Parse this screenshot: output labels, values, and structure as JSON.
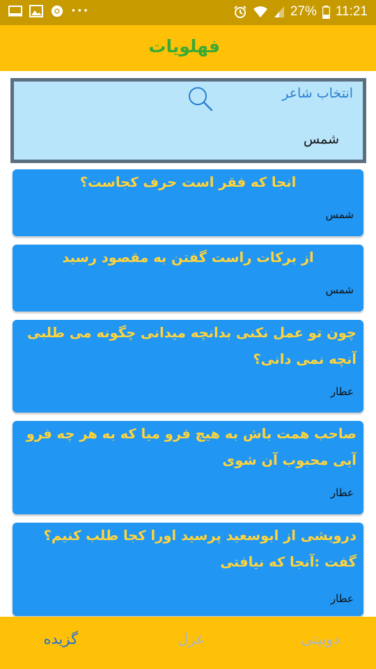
{
  "status_bar": {
    "icons_left": [
      "screen-icon",
      "image-icon",
      "chrome-icon",
      "more-dots-icon"
    ],
    "more": "···",
    "battery": "27%",
    "time": "11:21"
  },
  "app_bar": {
    "title": "فهلویات",
    "title_color": "#3aaa35",
    "background": "#ffc107"
  },
  "selector": {
    "label": "انتخاب شاعر",
    "value": "شمس"
  },
  "cards": [
    {
      "text": "انجا که فقر است حرف کجاست؟",
      "author": "شمس"
    },
    {
      "text": "از برکات راست گفتن به مقصود رسید",
      "author": "شمس"
    },
    {
      "text": "چون تو عمل نکنی بدانچه میدانی  چگونه می طلبی آنچه نمی دانی؟",
      "author": "عطار"
    },
    {
      "text": "صاحب همت باش به هیچ فرو میا که به هر چه فرو آیی محبوب آن شوی",
      "author": "عطار"
    },
    {
      "text": "درویشی از ابوسعید پرسید اورا کجا طلب کنیم؟ گفت :آنجا که نیافتی",
      "author": "عطار"
    }
  ],
  "bottom_nav": {
    "tabs": [
      {
        "label": "گزیده",
        "active": true
      },
      {
        "label": "غزل",
        "active": false
      },
      {
        "label": "دوبیتی",
        "active": false
      }
    ]
  },
  "colors": {
    "card": "#2196f3",
    "card_text": "#ffd43b",
    "accent": "#ffc107",
    "selector_bg": "#b9e5fb",
    "nav_active": "#1e6fd9",
    "nav_inactive": "#a8b6c8"
  }
}
